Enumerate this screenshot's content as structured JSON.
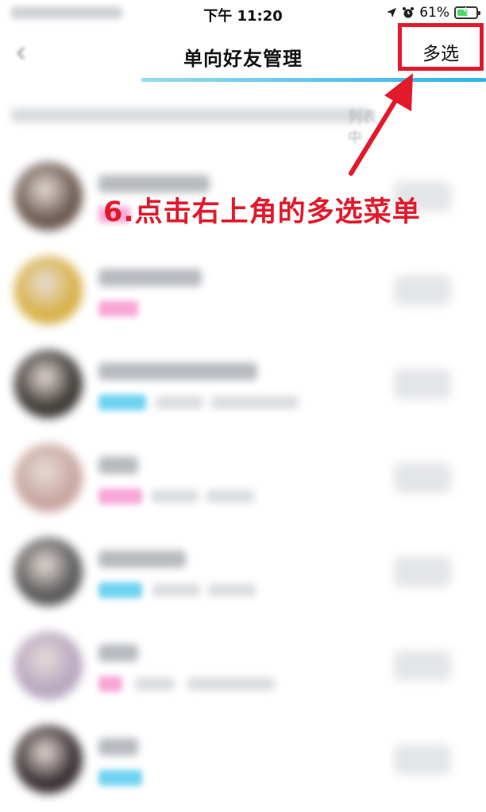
{
  "status_bar": {
    "time": "下午 11:20",
    "battery_percent": "61%",
    "battery_level": 0.61
  },
  "navbar": {
    "title": "单向好友管理",
    "multi_select_label": "多选"
  },
  "hint": {
    "visible_text_fragment": "列表中"
  },
  "annotation": {
    "text": "6.点击右上角的多选菜单",
    "color": "#e2192b"
  },
  "colors": {
    "accent_blue": "#2bb3e8",
    "tag_pink": "#f7a6d6",
    "tag_blue": "#6fd2f2",
    "annotation_red": "#e2192b"
  },
  "friends": [
    {
      "avatar_color": "#6b5a52",
      "tag_color": "#f7a6d6",
      "has_sub": false,
      "icon": "avatar-photo"
    },
    {
      "avatar_color": "#d8b24a",
      "tag_color": "#f7a6d6",
      "has_sub": false,
      "icon": "avatar-photo"
    },
    {
      "avatar_color": "#3e3a36",
      "tag_color": "#6fd2f2",
      "has_sub": true,
      "icon": "avatar-photo"
    },
    {
      "avatar_color": "#c9a6a0",
      "tag_color": "#f7a6d6",
      "has_sub": true,
      "icon": "avatar-photo"
    },
    {
      "avatar_color": "#5a5a5a",
      "tag_color": "#6fd2f2",
      "has_sub": true,
      "icon": "avatar-photo"
    },
    {
      "avatar_color": "#b8a8c0",
      "tag_color": "#f7a6d6",
      "has_sub": true,
      "icon": "avatar-photo"
    },
    {
      "avatar_color": "#3a3134",
      "tag_color": "#6fd2f2",
      "has_sub": false,
      "icon": "avatar-photo"
    }
  ]
}
